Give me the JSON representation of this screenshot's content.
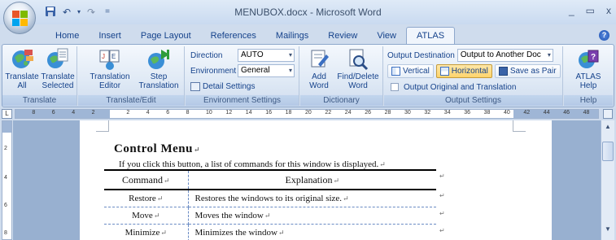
{
  "window": {
    "title": "MENUBOX.docx - Microsoft Word",
    "controls": {
      "minimize": "_",
      "maximize": "▭",
      "close": "x"
    }
  },
  "qat": {
    "save_icon": "save-icon",
    "undo_icon": "undo-icon",
    "redo_icon": "redo-icon",
    "more": "="
  },
  "tabs": [
    "Home",
    "Insert",
    "Page Layout",
    "References",
    "Mailings",
    "Review",
    "View",
    "ATLAS"
  ],
  "active_tab": "ATLAS",
  "ribbon": {
    "translate_group": {
      "label": "Translate",
      "translate_all": "Translate All",
      "translate_all_l1": "Translate",
      "translate_all_l2": "All",
      "translate_selected_l1": "Translate",
      "translate_selected_l2": "Selected"
    },
    "translate_edit_group": {
      "label": "Translate/Edit",
      "editor_l1": "Translation",
      "editor_l2": "Editor",
      "step_l1": "Step",
      "step_l2": "Translation"
    },
    "env_group": {
      "label": "Environment Settings",
      "direction_label": "Direction",
      "direction_value": "AUTO",
      "environment_label": "Environment",
      "environment_value": "General",
      "detail_settings": "Detail Settings"
    },
    "dictionary_group": {
      "label": "Dictionary",
      "add_word_l1": "Add",
      "add_word_l2": "Word",
      "find_delete_l1": "Find/Delete",
      "find_delete_l2": "Word"
    },
    "output_group": {
      "label": "Output Settings",
      "destination_label": "Output Destination",
      "destination_value": "Output to Another Doc",
      "vertical": "Vertical",
      "horizontal": "Horizontal",
      "save_as_pair": "Save as Pair",
      "output_original": "Output Original and Translation"
    },
    "help_group": {
      "label": "Help",
      "atlas_help_l1": "ATLAS",
      "atlas_help_l2": "Help"
    }
  },
  "ruler": {
    "corner": "L",
    "numbers_left": [
      "8",
      "6",
      "4",
      "2"
    ],
    "numbers_right": [
      "2",
      "4",
      "6",
      "8",
      "10",
      "12",
      "14",
      "16",
      "18",
      "20",
      "22",
      "24",
      "26",
      "28",
      "30",
      "32",
      "34",
      "36",
      "38",
      "40",
      "42",
      "44",
      "46",
      "48"
    ],
    "vertical_numbers": [
      "2",
      "4",
      "6",
      "8"
    ]
  },
  "document": {
    "heading": "Control Menu",
    "paragraph": "If you click this button, a list of commands for this window is displayed.",
    "table": {
      "headers": [
        "Command",
        "Explanation"
      ],
      "rows": [
        [
          "Restore",
          "Restores the windows to its original size."
        ],
        [
          "Move",
          "Moves the window"
        ],
        [
          "Minimize",
          "Minimizes the window"
        ]
      ]
    },
    "para_mark": "↵"
  },
  "colors": {
    "ribbon_text": "#15428b",
    "active_output": "#ffd46c",
    "doc_bg": "#98b0d0"
  }
}
